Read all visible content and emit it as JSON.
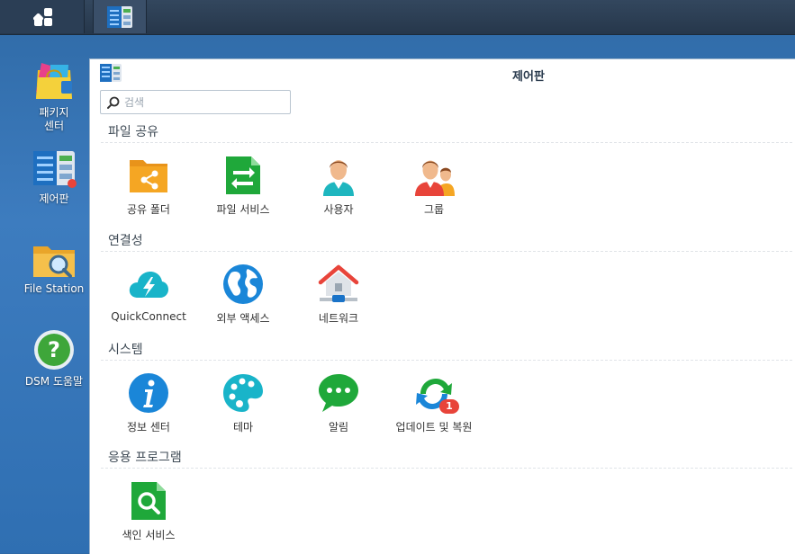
{
  "taskbar": {
    "main_menu_icon": "grid-icon",
    "open_app_icon": "control-panel-icon"
  },
  "desktop": {
    "icons": [
      {
        "label": "패키지\n센터",
        "icon": "package-center-icon"
      },
      {
        "label": "제어판",
        "icon": "control-panel-icon"
      },
      {
        "label": "File Station",
        "icon": "file-station-icon"
      },
      {
        "label": "DSM 도움말",
        "icon": "help-icon"
      }
    ]
  },
  "window": {
    "title": "제어판",
    "search": {
      "placeholder": "검색",
      "value": ""
    },
    "sections": [
      {
        "title": "파일 공유",
        "items": [
          {
            "label": "공유 폴더",
            "icon": "shared-folder-icon"
          },
          {
            "label": "파일 서비스",
            "icon": "file-services-icon"
          },
          {
            "label": "사용자",
            "icon": "user-icon"
          },
          {
            "label": "그룹",
            "icon": "group-icon"
          }
        ]
      },
      {
        "title": "연결성",
        "items": [
          {
            "label": "QuickConnect",
            "icon": "quickconnect-cloud-icon"
          },
          {
            "label": "외부 액세스",
            "icon": "globe-icon"
          },
          {
            "label": "네트워크",
            "icon": "network-house-icon"
          }
        ]
      },
      {
        "title": "시스템",
        "items": [
          {
            "label": "정보 센터",
            "icon": "info-icon"
          },
          {
            "label": "테마",
            "icon": "palette-icon"
          },
          {
            "label": "알림",
            "icon": "chat-bubble-icon"
          },
          {
            "label": "업데이트 및 복원",
            "icon": "update-restore-icon",
            "badge": "1"
          }
        ]
      },
      {
        "title": "응용 프로그램",
        "items": [
          {
            "label": "색인 서비스",
            "icon": "indexing-search-icon"
          }
        ]
      }
    ]
  },
  "colors": {
    "desktop_bg": "#3d7cbf",
    "taskbar_bg": "#2b3e55",
    "badge_red": "#e8443a",
    "folder_orange": "#f5a623",
    "green": "#1fa83a",
    "blue": "#1a86d8"
  }
}
